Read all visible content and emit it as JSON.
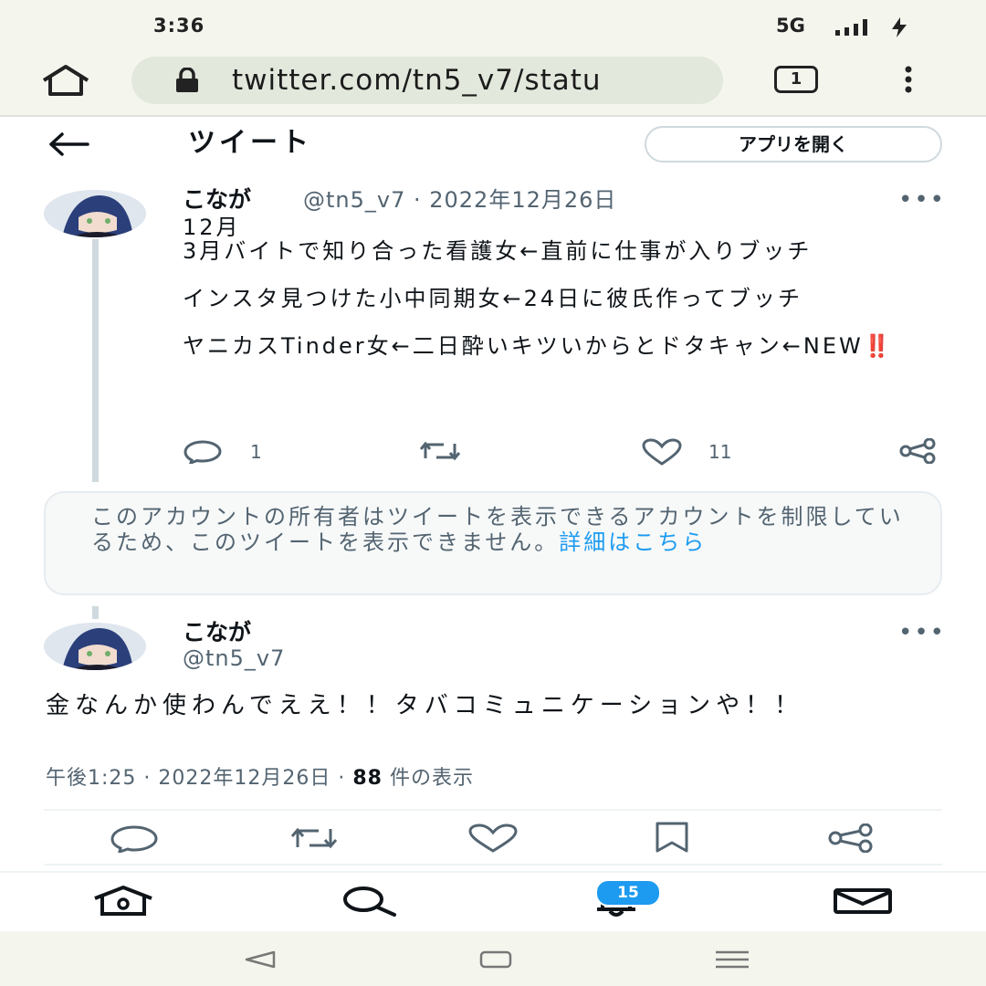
{
  "status_bar": {
    "time": "3:36",
    "network": "5G"
  },
  "browser": {
    "url": "twitter.com/tn5_v7/statu",
    "tab_count": "1"
  },
  "header": {
    "title": "ツイート",
    "open_app_label": "アプリを開く"
  },
  "tweet1": {
    "display_name": "こなが",
    "handle_date": "@tn5_v7 · 2022年12月26日",
    "lines": [
      "12月\n3月バイトで知り合った看護女←直前に仕事が入りブッチ",
      "インスタ見つけた小中同期女←24日に彼氏作ってブッチ",
      "ヤニカスTinder女←二日酔いキツいからとドタキャン←NEW‼️"
    ],
    "reply_count": "1",
    "like_count": "11"
  },
  "notice": {
    "text": "このアカウントの所有者はツイートを表示できるアカウントを制限しているため、このツイートを表示できません。",
    "link_text": "詳細はこちら"
  },
  "tweet2": {
    "display_name": "こなが",
    "handle": "@tn5_v7",
    "text": "金なんか使わんでええ！！タバコミュニケーションや！！",
    "time_date": "午後1:25 · 2022年12月26日 · ",
    "view_count": "88",
    "view_label": " 件の表示"
  },
  "bottom_nav": {
    "notification_badge": "15"
  },
  "colors": {
    "accent": "#1d9bf0",
    "muted": "#536471",
    "browser_bg": "#f4f6ee"
  },
  "icons": [
    "home-icon",
    "lock-icon",
    "tabs-icon",
    "menu-icon",
    "back-arrow-icon",
    "reply-icon",
    "retweet-icon",
    "like-icon",
    "share-icon",
    "bookmark-icon",
    "search-icon",
    "bell-icon",
    "mail-icon"
  ]
}
